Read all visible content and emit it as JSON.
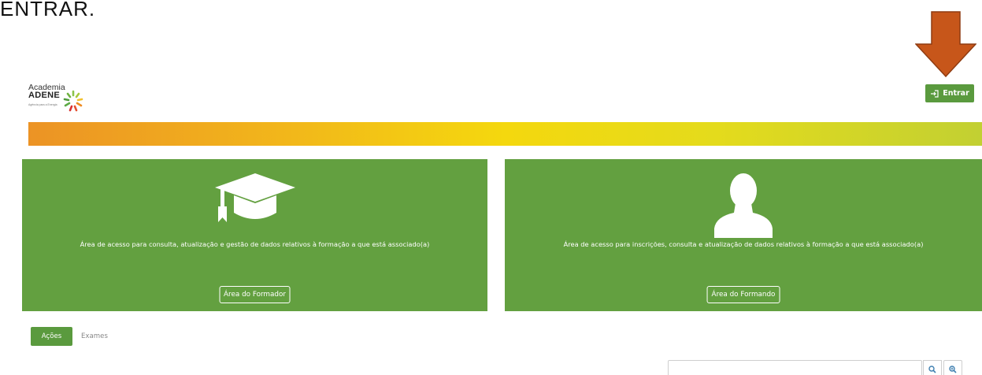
{
  "instruction": {
    "text": "ENTRAR."
  },
  "logo": {
    "line1": "Academia",
    "line2": "ADENE",
    "tagline": "Agência para a Energia"
  },
  "header": {
    "login_label": "Entrar"
  },
  "cards": [
    {
      "description": "Área de acesso para consulta, atualização e gestão de dados relativos à formação a que está associado(a)",
      "button_label": "Área do Formador",
      "icon": "graduation-cap-icon"
    },
    {
      "description": "Área de acesso para inscrições, consulta e atualização de dados relativos à formação a que está associado(a)",
      "button_label": "Área do Formando",
      "icon": "user-silhouette-icon"
    }
  ],
  "tabs": [
    {
      "label": "Ações",
      "active": true
    },
    {
      "label": "Exames",
      "active": false
    }
  ],
  "search": {
    "placeholder": "",
    "value": "",
    "button_icons": [
      "search-icon",
      "zoom-in-icon"
    ]
  },
  "colors": {
    "brand_green": "#63a040",
    "button_green": "#5a9a3e",
    "arrow_orange": "#c7561a",
    "banner_start": "#ec9325",
    "banner_end": "#c2d032"
  }
}
